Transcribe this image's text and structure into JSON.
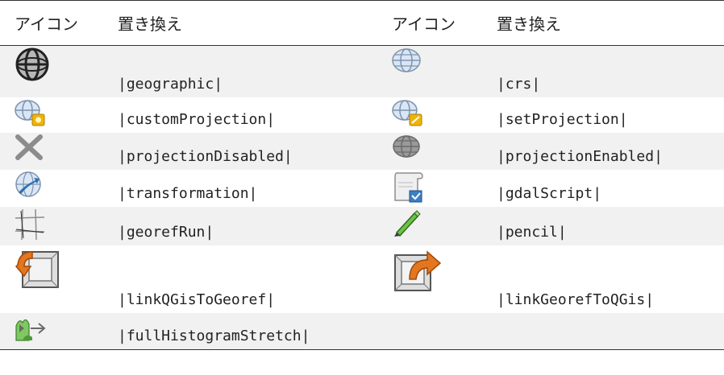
{
  "headers": [
    "アイコン",
    "置き換え",
    "アイコン",
    "置き換え"
  ],
  "rows": [
    {
      "left": {
        "icon": "geographic-icon",
        "text": "|geographic|"
      },
      "right": {
        "icon": "crs-icon",
        "text": "|crs|"
      }
    },
    {
      "left": {
        "icon": "custom-projection-icon",
        "text": "|customProjection|"
      },
      "right": {
        "icon": "set-projection-icon",
        "text": "|setProjection|"
      }
    },
    {
      "left": {
        "icon": "projection-disabled-icon",
        "text": "|projectionDisabled|"
      },
      "right": {
        "icon": "projection-enabled-icon",
        "text": "|projectionEnabled|"
      }
    },
    {
      "left": {
        "icon": "transformation-icon",
        "text": "|transformation|"
      },
      "right": {
        "icon": "gdal-script-icon",
        "text": "|gdalScript|"
      }
    },
    {
      "left": {
        "icon": "georef-run-icon",
        "text": "|georefRun|"
      },
      "right": {
        "icon": "pencil-icon",
        "text": "|pencil|"
      }
    },
    {
      "left": {
        "icon": "link-qgis-to-georef-icon",
        "text": "|linkQGisToGeoref|"
      },
      "right": {
        "icon": "link-georef-to-qgis-icon",
        "text": "|linkGeorefToQGis|"
      }
    },
    {
      "left": {
        "icon": "full-histogram-stretch-icon",
        "text": "|fullHistogramStretch|"
      },
      "right": {
        "icon": "",
        "text": ""
      }
    }
  ]
}
